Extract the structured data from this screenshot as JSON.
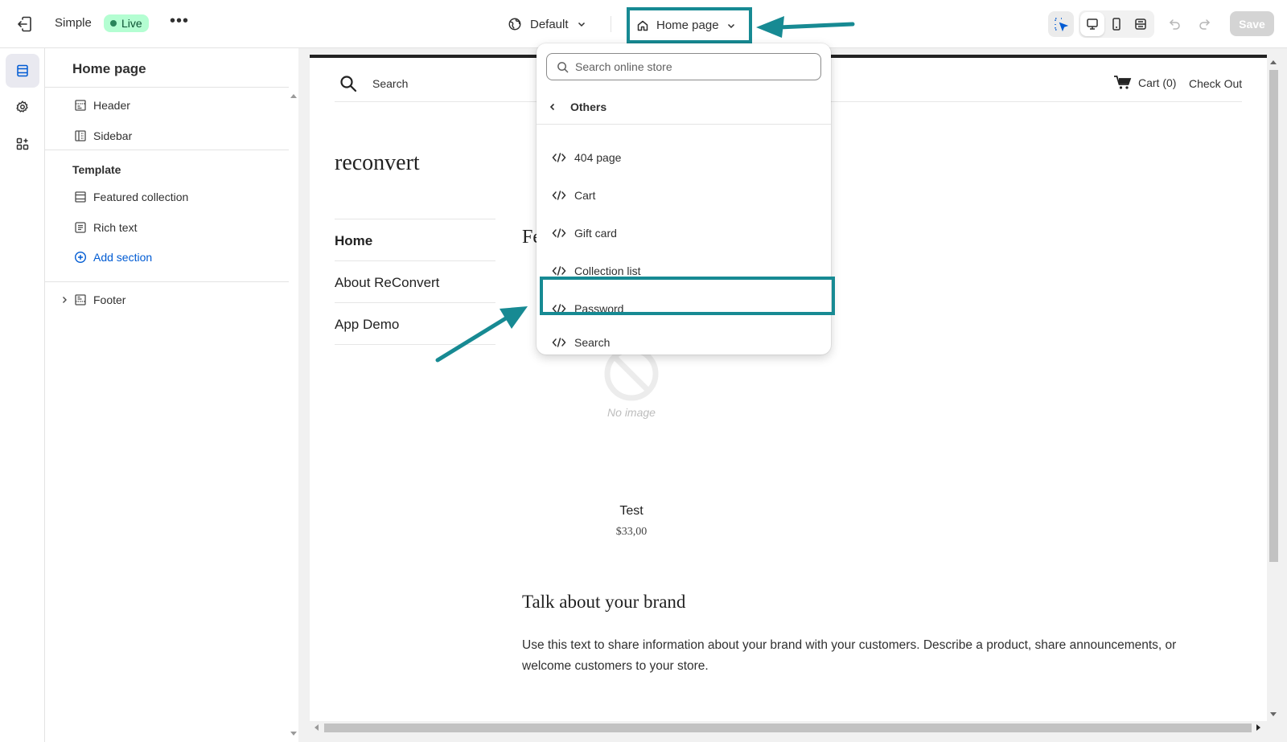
{
  "topbar": {
    "theme_name": "Simple",
    "live_badge": "Live",
    "more_label": "•••",
    "default_label": "Default",
    "page_selector_label": "Home page",
    "save_label": "Save"
  },
  "sidebar": {
    "title": "Home page",
    "header_item": "Header",
    "sidebar_item": "Sidebar",
    "template_label": "Template",
    "featured_collection": "Featured collection",
    "rich_text": "Rich text",
    "add_section": "Add section",
    "footer_item": "Footer"
  },
  "preview": {
    "search_label": "Search",
    "cart_label": "Cart (0)",
    "checkout_label": "Check Out",
    "logo": "reconvert",
    "nav": [
      "Home",
      "About ReConvert",
      "App Demo"
    ],
    "featured_heading": "Fe",
    "no_image": "No image",
    "product_name": "Test",
    "product_price": "$33,00",
    "rich_heading": "Talk about your brand",
    "rich_body": "Use this text to share information about your brand with your customers. Describe a product, share announcements, or welcome customers to your store."
  },
  "dropdown": {
    "search_placeholder": "Search online store",
    "back_label": "Others",
    "items": [
      "404 page",
      "Cart",
      "Gift card",
      "Collection list",
      "Password",
      "Search"
    ]
  },
  "colors": {
    "annotation": "#178a93",
    "live_bg": "#b4fed2",
    "link_blue": "#005bd3"
  }
}
